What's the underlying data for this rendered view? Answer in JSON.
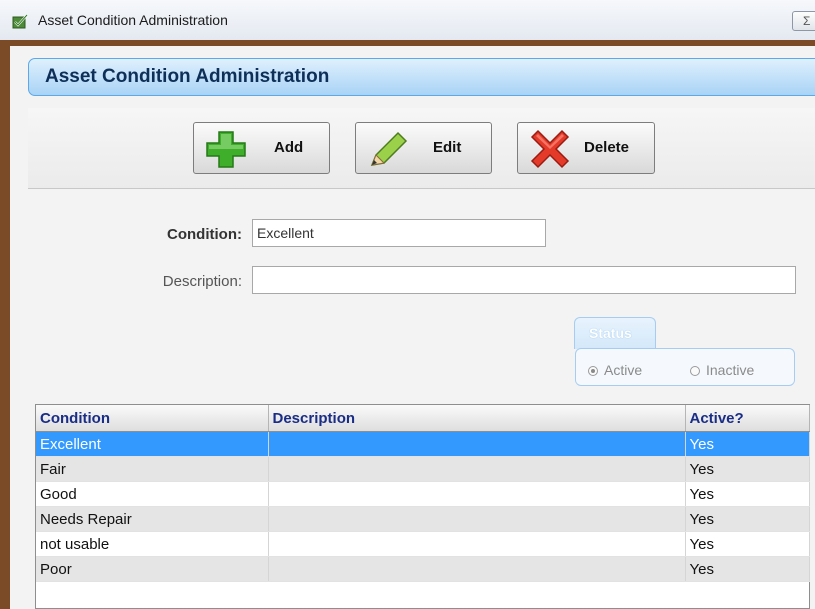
{
  "window": {
    "title": "Asset Condition Administration",
    "close_glyph": "Σ"
  },
  "header": {
    "title": "Asset Condition Administration"
  },
  "toolbar": {
    "add_label": "Add",
    "edit_label": "Edit",
    "delete_label": "Delete"
  },
  "form": {
    "condition_label": "Condition:",
    "condition_value": "Excellent",
    "description_label": "Description:",
    "description_value": ""
  },
  "status": {
    "label": "Status",
    "options": [
      "Active",
      "Inactive"
    ],
    "selected": "Active"
  },
  "grid": {
    "columns": [
      "Condition",
      "Description",
      "Active?"
    ],
    "rows": [
      [
        "Excellent",
        "",
        "Yes"
      ],
      [
        "Fair",
        "",
        "Yes"
      ],
      [
        "Good",
        "",
        "Yes"
      ],
      [
        "Needs Repair",
        "",
        "Yes"
      ],
      [
        "not usable",
        "",
        "Yes"
      ],
      [
        "Poor",
        "",
        "Yes"
      ]
    ],
    "selected_row": 0
  },
  "colors": {
    "selection": "#3399ff",
    "header_text": "#1a2d86",
    "frame": "#7b4a26"
  }
}
